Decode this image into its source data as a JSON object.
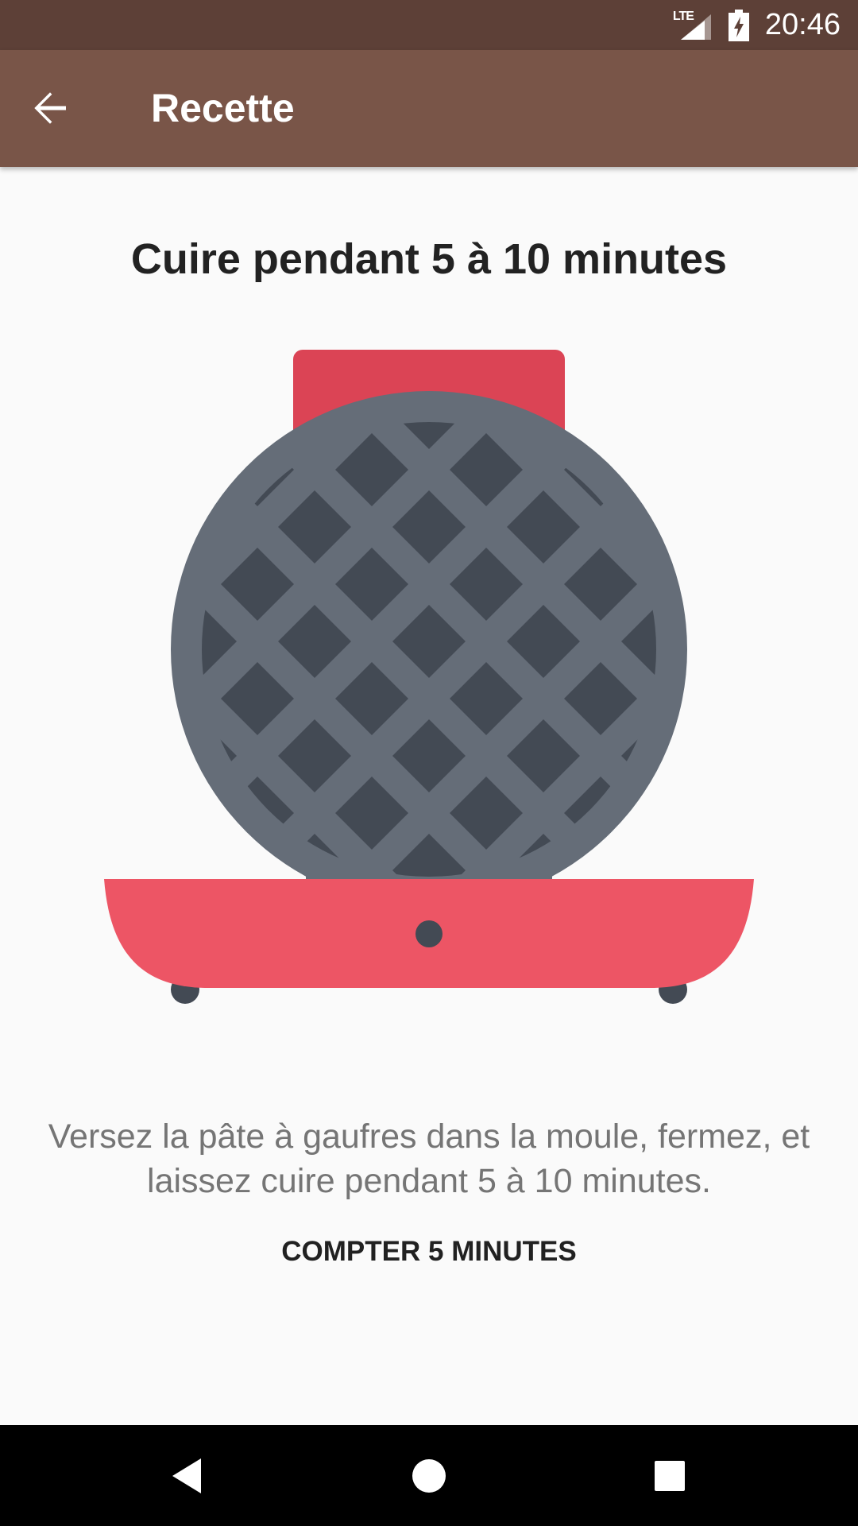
{
  "status_bar": {
    "network": "LTE",
    "time": "20:46",
    "icons": [
      "lte-signal-icon",
      "battery-charging-icon"
    ]
  },
  "app_bar": {
    "back_icon": "arrow-back-icon",
    "title": "Recette"
  },
  "step": {
    "title": "Cuire pendant 5 à 10 minutes",
    "illustration": "waffle-iron",
    "description": "Versez la pâte à gaufres dans la moule, fermez, et laissez cuire pendant 5 à 10 minutes.",
    "timer_button_label": "COMPTER 5 MINUTES"
  },
  "nav_bar": {
    "icons": [
      "back-triangle-icon",
      "home-circle-icon",
      "recents-square-icon"
    ]
  },
  "colors": {
    "status_bar": "#5d4037",
    "app_bar": "#795548",
    "background": "#fafafa",
    "waffle_red_top": "#db4455",
    "waffle_red_base": "#ed5565",
    "waffle_plate": "#656d78",
    "waffle_squares": "#434a54"
  }
}
